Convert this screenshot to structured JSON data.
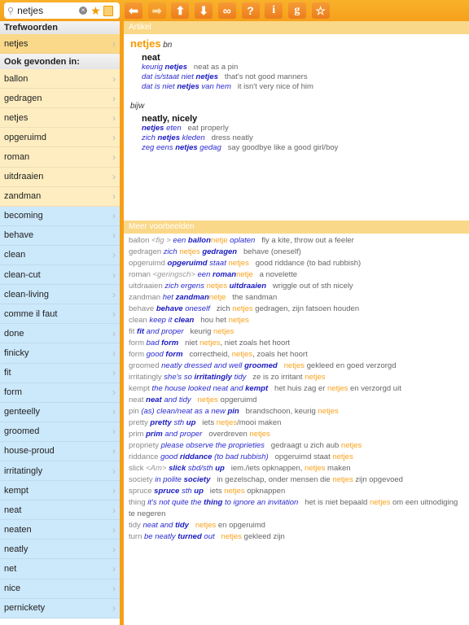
{
  "search": {
    "value": "netjes",
    "placeholder": ""
  },
  "toolbar": [
    {
      "name": "back-arrow-icon",
      "glyph": "⬅"
    },
    {
      "name": "forward-arrow-icon",
      "glyph": "➡"
    },
    {
      "name": "up-arrow-icon",
      "glyph": "⬆"
    },
    {
      "name": "down-arrow-icon",
      "glyph": "⬇"
    },
    {
      "name": "link-icon",
      "glyph": "∞"
    },
    {
      "name": "help-icon",
      "glyph": "?"
    },
    {
      "name": "info-icon",
      "glyph": "i"
    },
    {
      "name": "google-icon",
      "glyph": "g"
    },
    {
      "name": "favorite-star-icon",
      "glyph": "☆"
    }
  ],
  "sidebar": {
    "keywords_header": "Trefwoorden",
    "keyword": "netjes",
    "found_header": "Ook gevonden in:",
    "dutch": [
      "ballon",
      "gedragen",
      "netjes",
      "opgeruimd",
      "roman",
      "uitdraaien",
      "zandman"
    ],
    "english": [
      "becoming",
      "behave",
      "clean",
      "clean-cut",
      "clean-living",
      "comme il faut",
      "done",
      "finicky",
      "fit",
      "form",
      "genteelly",
      "groomed",
      "house-proud",
      "irritatingly",
      "kempt",
      "neat",
      "neaten",
      "neatly",
      "net",
      "nice",
      "pernickety"
    ]
  },
  "article": {
    "header": "Artikel",
    "headword": "netjes",
    "pos1": "bn",
    "pos2": "bijw",
    "senses": [
      {
        "translation": "neat",
        "examples": [
          [
            [
              "b",
              "keurig "
            ],
            [
              "B",
              "netjes"
            ],
            [
              "t",
              "   neat as a pin"
            ]
          ],
          [
            [
              "b",
              "dat is/staat niet "
            ],
            [
              "B",
              "netjes"
            ],
            [
              "t",
              "   that's not good manners"
            ]
          ],
          [
            [
              "b",
              "dat is niet "
            ],
            [
              "B",
              "netjes"
            ],
            [
              "b",
              " van hem"
            ],
            [
              "t",
              "   it isn't very nice of him"
            ]
          ]
        ]
      },
      {
        "translation": "neatly, nicely",
        "examples": [
          [
            [
              "B",
              "netjes"
            ],
            [
              "b",
              " eten"
            ],
            [
              "t",
              "   eat properly"
            ]
          ],
          [
            [
              "b",
              "zich "
            ],
            [
              "B",
              "netjes"
            ],
            [
              "b",
              " kleden"
            ],
            [
              "t",
              "   dress neatly"
            ]
          ],
          [
            [
              "b",
              "zeg eens "
            ],
            [
              "B",
              "netjes"
            ],
            [
              "b",
              " gedag"
            ],
            [
              "t",
              "   say goodbye like a good girl/boy"
            ]
          ]
        ]
      }
    ]
  },
  "more": {
    "header": "Meer voorbeelden",
    "examples": [
      [
        [
          "g",
          "ballon "
        ],
        [
          "gi",
          "<fig > "
        ],
        [
          "b",
          "een "
        ],
        [
          "B",
          "ballon"
        ],
        [
          "o",
          "netje"
        ],
        [
          "b",
          " oplaten"
        ],
        [
          "t",
          "   fly a kite, throw out a feeler"
        ]
      ],
      [
        [
          "g",
          "gedragen "
        ],
        [
          "b",
          "zich "
        ],
        [
          "o",
          "netjes "
        ],
        [
          "B",
          "gedragen"
        ],
        [
          "t",
          "   behave (oneself)"
        ]
      ],
      [
        [
          "g",
          "opgeruimd "
        ],
        [
          "B",
          "opgeruimd"
        ],
        [
          "b",
          " staat "
        ],
        [
          "o",
          "netjes"
        ],
        [
          "t",
          "   good riddance (to bad rubbish)"
        ]
      ],
      [
        [
          "g",
          "roman "
        ],
        [
          "gi",
          "<geringsch> "
        ],
        [
          "b",
          "een "
        ],
        [
          "B",
          "roman"
        ],
        [
          "o",
          "netje"
        ],
        [
          "t",
          "   a novelette"
        ]
      ],
      [
        [
          "g",
          "uitdraaien "
        ],
        [
          "b",
          "zich ergens "
        ],
        [
          "o",
          "netjes "
        ],
        [
          "B",
          "uitdraaien"
        ],
        [
          "t",
          "   wriggle out of sth nicely"
        ]
      ],
      [
        [
          "g",
          "zandman "
        ],
        [
          "b",
          "het "
        ],
        [
          "B",
          "zandman"
        ],
        [
          "o",
          "netje"
        ],
        [
          "t",
          "   the sandman"
        ]
      ],
      [
        [
          "g",
          "behave "
        ],
        [
          "B",
          "behave"
        ],
        [
          "b",
          " oneself"
        ],
        [
          "t",
          "   zich "
        ],
        [
          "o",
          "netjes"
        ],
        [
          "t",
          " gedragen, zijn fatsoen houden"
        ]
      ],
      [
        [
          "g",
          "clean "
        ],
        [
          "b",
          "keep it "
        ],
        [
          "B",
          "clean"
        ],
        [
          "t",
          "   hou het "
        ],
        [
          "o",
          "netjes"
        ]
      ],
      [
        [
          "g",
          "fit "
        ],
        [
          "B",
          "fit"
        ],
        [
          "b",
          " and proper"
        ],
        [
          "t",
          "   keurig "
        ],
        [
          "o",
          "netjes"
        ]
      ],
      [
        [
          "g",
          "form "
        ],
        [
          "b",
          "bad "
        ],
        [
          "B",
          "form"
        ],
        [
          "t",
          "   niet "
        ],
        [
          "o",
          "netjes"
        ],
        [
          "t",
          ", niet zoals het hoort"
        ]
      ],
      [
        [
          "g",
          "form "
        ],
        [
          "b",
          "good "
        ],
        [
          "B",
          "form"
        ],
        [
          "t",
          "   correctheid, "
        ],
        [
          "o",
          "netjes"
        ],
        [
          "t",
          ", zoals het hoort"
        ]
      ],
      [
        [
          "g",
          "groomed "
        ],
        [
          "b",
          "neatly dressed and well "
        ],
        [
          "B",
          "groomed"
        ],
        [
          "o",
          "   netjes"
        ],
        [
          "t",
          " gekleed en goed verzorgd"
        ]
      ],
      [
        [
          "g",
          "irritatingly "
        ],
        [
          "b",
          "she's so "
        ],
        [
          "B",
          "irritatingly"
        ],
        [
          "b",
          " tidy"
        ],
        [
          "t",
          "   ze is zo irritant "
        ],
        [
          "o",
          "netjes"
        ]
      ],
      [
        [
          "g",
          "kempt "
        ],
        [
          "b",
          "the house looked neat and "
        ],
        [
          "B",
          "kempt"
        ],
        [
          "t",
          "   het huis zag er "
        ],
        [
          "o",
          "netjes"
        ],
        [
          "t",
          " en verzorgd uit"
        ]
      ],
      [
        [
          "g",
          "neat "
        ],
        [
          "B",
          "neat"
        ],
        [
          "b",
          " and tidy"
        ],
        [
          "o",
          "   netjes"
        ],
        [
          "t",
          " opgeruimd"
        ]
      ],
      [
        [
          "g",
          "pin "
        ],
        [
          "b",
          "(as) clean/neat as a new "
        ],
        [
          "B",
          "pin"
        ],
        [
          "t",
          "   brandschoon, keurig "
        ],
        [
          "o",
          "netjes"
        ]
      ],
      [
        [
          "g",
          "pretty "
        ],
        [
          "B",
          "pretty"
        ],
        [
          "b",
          " sth "
        ],
        [
          "B",
          "up"
        ],
        [
          "t",
          "   iets "
        ],
        [
          "o",
          "netjes"
        ],
        [
          "t",
          "/mooi maken"
        ]
      ],
      [
        [
          "g",
          "prim "
        ],
        [
          "B",
          "prim"
        ],
        [
          "b",
          " and proper"
        ],
        [
          "t",
          "   overdreven "
        ],
        [
          "o",
          "netjes"
        ]
      ],
      [
        [
          "g",
          "propriety "
        ],
        [
          "b",
          "please observe the proprieties"
        ],
        [
          "t",
          "   gedraagt u zich aub "
        ],
        [
          "o",
          "netjes"
        ]
      ],
      [
        [
          "g",
          "riddance "
        ],
        [
          "b",
          "good "
        ],
        [
          "B",
          "riddance"
        ],
        [
          "b",
          " (to bad rubbish)"
        ],
        [
          "t",
          "   opgeruimd staat "
        ],
        [
          "o",
          "netjes"
        ]
      ],
      [
        [
          "g",
          "slick "
        ],
        [
          "gi",
          "<Am> "
        ],
        [
          "B",
          "slick"
        ],
        [
          "b",
          " sbd/sth "
        ],
        [
          "B",
          "up"
        ],
        [
          "t",
          "   iem./iets opknappen, "
        ],
        [
          "o",
          "netjes"
        ],
        [
          "t",
          " maken"
        ]
      ],
      [
        [
          "g",
          "society "
        ],
        [
          "b",
          "in polite "
        ],
        [
          "B",
          "society"
        ],
        [
          "t",
          "   in gezelschap, onder mensen die "
        ],
        [
          "o",
          "netjes"
        ],
        [
          "t",
          " zijn opgevoed"
        ]
      ],
      [
        [
          "g",
          "spruce "
        ],
        [
          "B",
          "spruce"
        ],
        [
          "b",
          " sth "
        ],
        [
          "B",
          "up"
        ],
        [
          "t",
          "   iets "
        ],
        [
          "o",
          "netjes"
        ],
        [
          "t",
          " opknappen"
        ]
      ],
      [
        [
          "g",
          "thing "
        ],
        [
          "b",
          "it's not quite the "
        ],
        [
          "B",
          "thing"
        ],
        [
          "b",
          " to ignore an invitation"
        ],
        [
          "t",
          "   het is niet bepaald "
        ],
        [
          "o",
          "netjes"
        ],
        [
          "t",
          " om een uitnodiging te negeren"
        ]
      ],
      [
        [
          "g",
          "tidy "
        ],
        [
          "b",
          "neat and "
        ],
        [
          "B",
          "tidy"
        ],
        [
          "o",
          "   netjes"
        ],
        [
          "t",
          " en opgeruimd"
        ]
      ],
      [
        [
          "g",
          "turn "
        ],
        [
          "b",
          "be neatly "
        ],
        [
          "B",
          "turned"
        ],
        [
          "b",
          " out"
        ],
        [
          "o",
          "   netjes"
        ],
        [
          "t",
          " gekleed zijn"
        ]
      ]
    ]
  }
}
